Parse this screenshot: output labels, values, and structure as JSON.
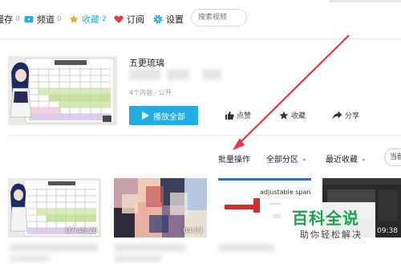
{
  "nav": {
    "items": [
      {
        "label": "缓存",
        "count": "0"
      },
      {
        "label": "频道",
        "count": "0"
      },
      {
        "label": "收藏",
        "count": "2"
      },
      {
        "label": "订阅",
        "count": ""
      },
      {
        "label": "设置",
        "count": ""
      }
    ],
    "search_placeholder": "搜索视频"
  },
  "playlist": {
    "title": "五更琉璃",
    "meta": "4个内容 · 公开",
    "play_all": "播放全部",
    "like": "点赞",
    "favorite": "收藏",
    "share": "分享"
  },
  "controls": {
    "batch": "批量操作",
    "category": "全部分区",
    "sort": "最近收藏",
    "search_partial": "当前"
  },
  "videos": [
    {
      "duration": "07:48:25"
    },
    {
      "duration": "04:01"
    },
    {
      "duration": "",
      "caption": "adjustable spanner"
    },
    {
      "duration": "09:38"
    }
  ],
  "watermark": {
    "title": "百科全说",
    "subtitle": "助你轻松解决"
  },
  "colors": {
    "accent": "#23ade5",
    "arrow": "#e8383d",
    "watermark": "#1aa24a"
  },
  "icons": [
    "download-icon",
    "channel-icon",
    "star-icon",
    "heart-icon",
    "gear-icon",
    "play-icon",
    "thumb-up-icon",
    "star-icon",
    "share-icon"
  ]
}
